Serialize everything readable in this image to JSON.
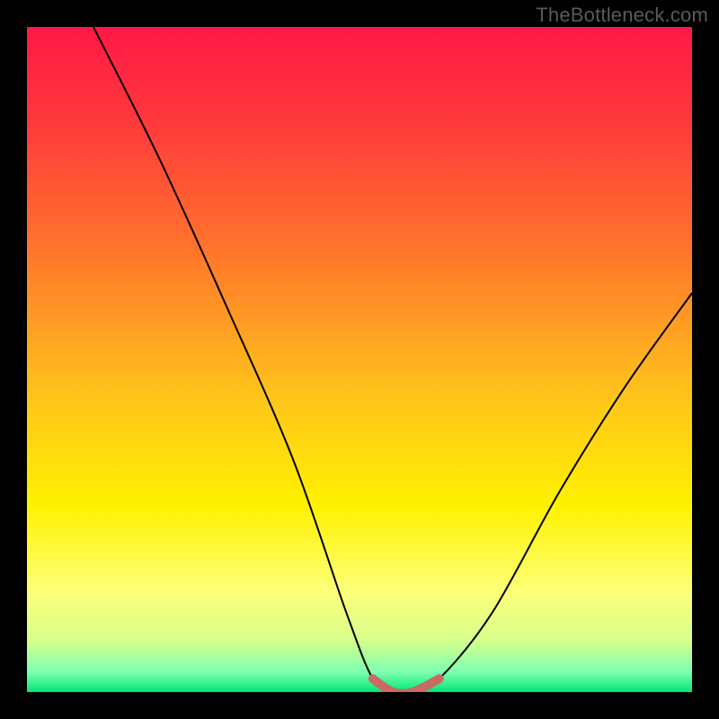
{
  "source_label": "TheBottleneck.com",
  "chart_data": {
    "type": "line",
    "title": "",
    "xlabel": "",
    "ylabel": "",
    "xlim": [
      0,
      100
    ],
    "ylim": [
      0,
      100
    ],
    "grid": false,
    "series": [
      {
        "name": "bottleneck-curve",
        "x": [
          10,
          20,
          30,
          40,
          48,
          52,
          55,
          58,
          62,
          70,
          80,
          90,
          100
        ],
        "y": [
          100,
          80,
          58,
          35,
          12,
          2,
          0,
          0,
          2,
          12,
          30,
          46,
          60
        ]
      },
      {
        "name": "optimal-range",
        "x": [
          52,
          55,
          58,
          62
        ],
        "y": [
          2,
          0,
          0,
          2
        ]
      }
    ],
    "background_gradient_stops": [
      {
        "pos": 0.0,
        "color": "#ff1846"
      },
      {
        "pos": 0.15,
        "color": "#ff3b3b"
      },
      {
        "pos": 0.35,
        "color": "#ff7a2a"
      },
      {
        "pos": 0.55,
        "color": "#ffc21c"
      },
      {
        "pos": 0.72,
        "color": "#fff200"
      },
      {
        "pos": 0.85,
        "color": "#fdff7a"
      },
      {
        "pos": 0.92,
        "color": "#d8ff8a"
      },
      {
        "pos": 0.97,
        "color": "#7dffb0"
      },
      {
        "pos": 1.0,
        "color": "#00e676"
      }
    ],
    "curve_color": "#000000",
    "optimal_range_color": "#c96a63"
  }
}
